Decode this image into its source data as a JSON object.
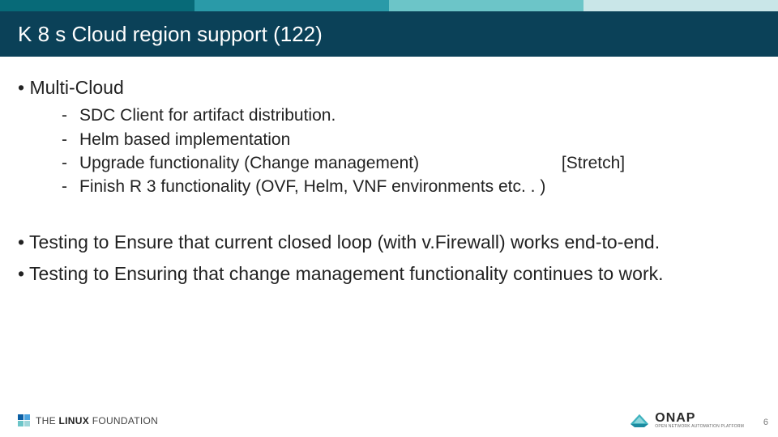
{
  "title": "K 8 s Cloud region support (122)",
  "bullets": {
    "b1": "Multi-Cloud",
    "sub": {
      "s1": "SDC Client for artifact distribution.",
      "s2": "Helm based implementation",
      "s3_main": "Upgrade functionality (Change management)",
      "s3_note": "[Stretch]",
      "s4": "Finish R 3 functionality (OVF, Helm,  VNF environments etc. . )"
    },
    "b2": "Testing to Ensure that current closed loop (with v.Firewall) works end-to-end.",
    "b3": "Testing to Ensuring that change management functionality continues to work."
  },
  "footer": {
    "lf_thin": "THE",
    "lf_bold1": "LINUX",
    "lf_bold2": "FOUNDATION",
    "onap_big": "ONAP",
    "onap_small": "OPEN NETWORK AUTOMATION PLATFORM",
    "page": "6"
  }
}
